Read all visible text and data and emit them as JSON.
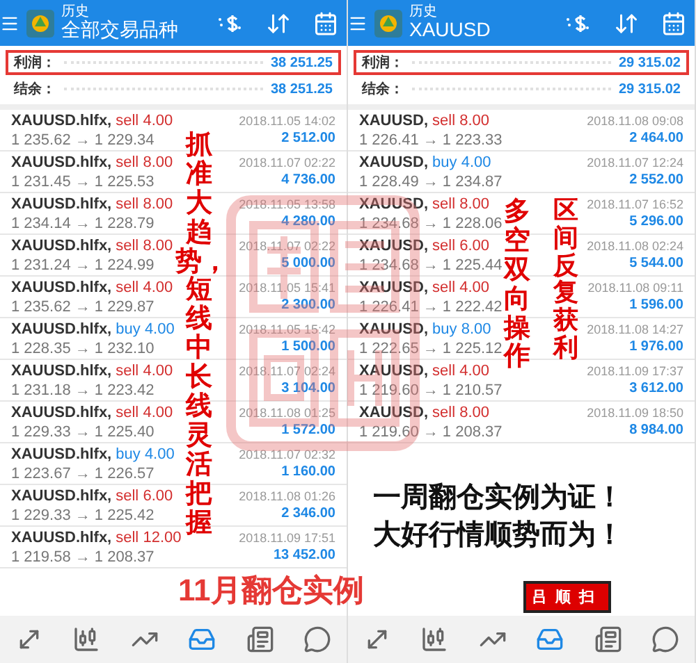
{
  "panels": [
    {
      "header": {
        "title": "历史",
        "subtitle": "全部交易品种"
      },
      "summary": [
        {
          "label": "利润：",
          "value": "38 251.25",
          "highlighted": true
        },
        {
          "label": "结余：",
          "value": "38 251.25",
          "highlighted": false
        }
      ],
      "trades": [
        {
          "symbol": "XAUUSD.hlfx,",
          "kind": "down",
          "side": "sell",
          "volume": "4.00",
          "prices": "1 235.62 → 1 229.34",
          "time": "2018.11.05 14:02",
          "profit": "2 512.00"
        },
        {
          "symbol": "XAUUSD.hlfx,",
          "kind": "down",
          "side": "sell",
          "volume": "8.00",
          "prices": "1 231.45 → 1 225.53",
          "time": "2018.11.07 02:22",
          "profit": "4 736.00"
        },
        {
          "symbol": "XAUUSD.hlfx,",
          "kind": "down",
          "side": "sell",
          "volume": "8.00",
          "prices": "1 234.14 → 1 228.79",
          "time": "2018.11.05 13:58",
          "profit": "4 280.00"
        },
        {
          "symbol": "XAUUSD.hlfx,",
          "kind": "down",
          "side": "sell",
          "volume": "8.00",
          "prices": "1 231.24 → 1 224.99",
          "time": "2018.11.07 02:22",
          "profit": "5 000.00"
        },
        {
          "symbol": "XAUUSD.hlfx,",
          "kind": "down",
          "side": "sell",
          "volume": "4.00",
          "prices": "1 235.62 → 1 229.87",
          "time": "2018.11.05 15:41",
          "profit": "2 300.00"
        },
        {
          "symbol": "XAUUSD.hlfx,",
          "kind": "up",
          "side": "buy",
          "volume": "4.00",
          "prices": "1 228.35 → 1 232.10",
          "time": "2018.11.05 15:42",
          "profit": "1 500.00"
        },
        {
          "symbol": "XAUUSD.hlfx,",
          "kind": "down",
          "side": "sell",
          "volume": "4.00",
          "prices": "1 231.18 → 1 223.42",
          "time": "2018.11.07 02:24",
          "profit": "3 104.00"
        },
        {
          "symbol": "XAUUSD.hlfx,",
          "kind": "down",
          "side": "sell",
          "volume": "4.00",
          "prices": "1 229.33 → 1 225.40",
          "time": "2018.11.08 01:25",
          "profit": "1 572.00"
        },
        {
          "symbol": "XAUUSD.hlfx,",
          "kind": "up",
          "side": "buy",
          "volume": "4.00",
          "prices": "1 223.67 → 1 226.57",
          "time": "2018.11.07 02:32",
          "profit": "1 160.00"
        },
        {
          "symbol": "XAUUSD.hlfx,",
          "kind": "down",
          "side": "sell",
          "volume": "6.00",
          "prices": "1 229.33 → 1 225.42",
          "time": "2018.11.08 01:26",
          "profit": "2 346.00"
        },
        {
          "symbol": "XAUUSD.hlfx,",
          "kind": "down",
          "side": "sell",
          "volume": "12.00",
          "prices": "1 219.58 → 1 208.37",
          "time": "2018.11.09 17:51",
          "profit": "13 452.00"
        }
      ],
      "nav": [
        {
          "selected": false
        },
        {
          "selected": false
        },
        {
          "selected": false
        },
        {
          "selected": true
        },
        {
          "selected": false
        },
        {
          "selected": false
        }
      ]
    },
    {
      "header": {
        "title": "历史",
        "subtitle": "XAUUSD"
      },
      "summary": [
        {
          "label": "利润：",
          "value": "29 315.02",
          "highlighted": true
        },
        {
          "label": "结余：",
          "value": "29 315.02",
          "highlighted": false
        }
      ],
      "trades": [
        {
          "symbol": "XAUUSD,",
          "kind": "down",
          "side": "sell",
          "volume": "8.00",
          "prices": "1 226.41 → 1 223.33",
          "time": "2018.11.08 09:08",
          "profit": "2 464.00"
        },
        {
          "symbol": "XAUUSD,",
          "kind": "up",
          "side": "buy",
          "volume": "4.00",
          "prices": "1 228.49 → 1 234.87",
          "time": "2018.11.07 12:24",
          "profit": "2 552.00"
        },
        {
          "symbol": "XAUUSD,",
          "kind": "down",
          "side": "sell",
          "volume": "8.00",
          "prices": "1 234.68 → 1 228.06",
          "time": "2018.11.07 16:52",
          "profit": "5 296.00"
        },
        {
          "symbol": "XAUUSD,",
          "kind": "down",
          "side": "sell",
          "volume": "6.00",
          "prices": "1 234.68 → 1 225.44",
          "time": "2018.11.08 02:24",
          "profit": "5 544.00"
        },
        {
          "symbol": "XAUUSD,",
          "kind": "down",
          "side": "sell",
          "volume": "4.00",
          "prices": "1 226.41 → 1 222.42",
          "time": "2018.11.08 09:11",
          "profit": "1 596.00"
        },
        {
          "symbol": "XAUUSD,",
          "kind": "up",
          "side": "buy",
          "volume": "8.00",
          "prices": "1 222.65 → 1 225.12",
          "time": "2018.11.08 14:27",
          "profit": "1 976.00"
        },
        {
          "symbol": "XAUUSD,",
          "kind": "down",
          "side": "sell",
          "volume": "4.00",
          "prices": "1 219.60 → 1 210.57",
          "time": "2018.11.09 17:37",
          "profit": "3 612.00"
        },
        {
          "symbol": "XAUUSD,",
          "kind": "down",
          "side": "sell",
          "volume": "8.00",
          "prices": "1 219.60 → 1 208.37",
          "time": "2018.11.09 18:50",
          "profit": "8 984.00"
        }
      ],
      "nav": [
        {
          "selected": false
        },
        {
          "selected": false
        },
        {
          "selected": false
        },
        {
          "selected": true
        },
        {
          "selected": false
        },
        {
          "selected": false
        }
      ]
    }
  ],
  "overlays": [
    {
      "kind": "vertical",
      "text": "抓准大趋势，短线中长线灵活把握"
    },
    {
      "kind": "vertical",
      "text": "多空双向操作"
    },
    {
      "kind": "vertical",
      "text": "区间反复获利"
    },
    {
      "kind": "caption",
      "text": "11月翻仓实例"
    },
    {
      "kind": "slogan",
      "text": "一周翻仓实例为证！"
    },
    {
      "kind": "slogan",
      "text": "大好行情顺势而为！"
    },
    {
      "kind": "signature",
      "text": "吕顺扫"
    }
  ]
}
